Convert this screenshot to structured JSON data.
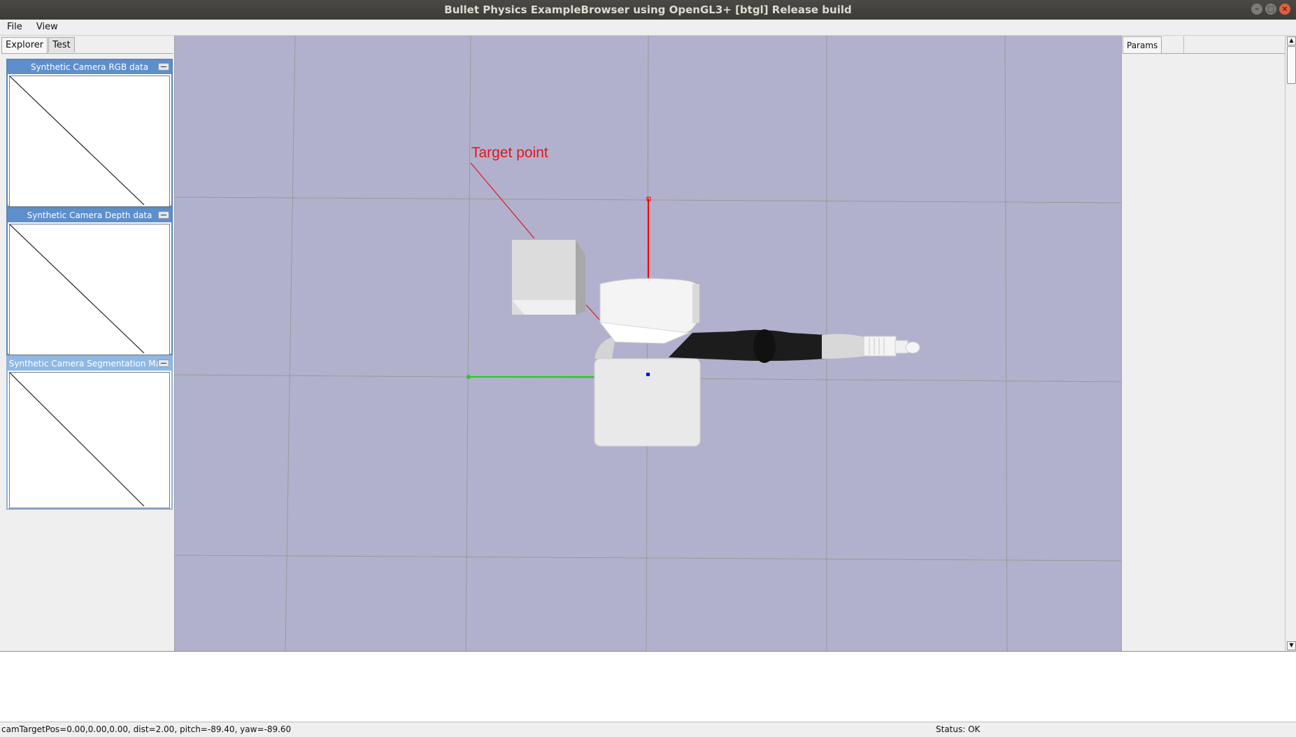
{
  "window": {
    "title": "Bullet Physics ExampleBrowser using OpenGL3+ [btgl] Release build"
  },
  "menu": {
    "items": [
      "File",
      "View"
    ]
  },
  "left_panel": {
    "tabs": [
      "Explorer",
      "Test"
    ],
    "camera_windows": [
      {
        "title": "Synthetic Camera RGB data"
      },
      {
        "title": "Synthetic Camera Depth data"
      },
      {
        "title": "Synthetic Camera Segmentation Mask"
      }
    ]
  },
  "viewport": {
    "target_label": "Target point"
  },
  "right_panel": {
    "tabs": [
      "Params"
    ]
  },
  "status": {
    "camera": "camTargetPos=0.00,0.00,0.00, dist=2.00, pitch=-89.40, yaw=-89.60",
    "state": "Status: OK"
  },
  "colors": {
    "viewport_bg": "#b1b1cd",
    "grid": "#999999",
    "axis_x": "#ff0000",
    "axis_y": "#00cc00",
    "target": "#e8141b",
    "camera_title_active": "#5d8fcd"
  }
}
